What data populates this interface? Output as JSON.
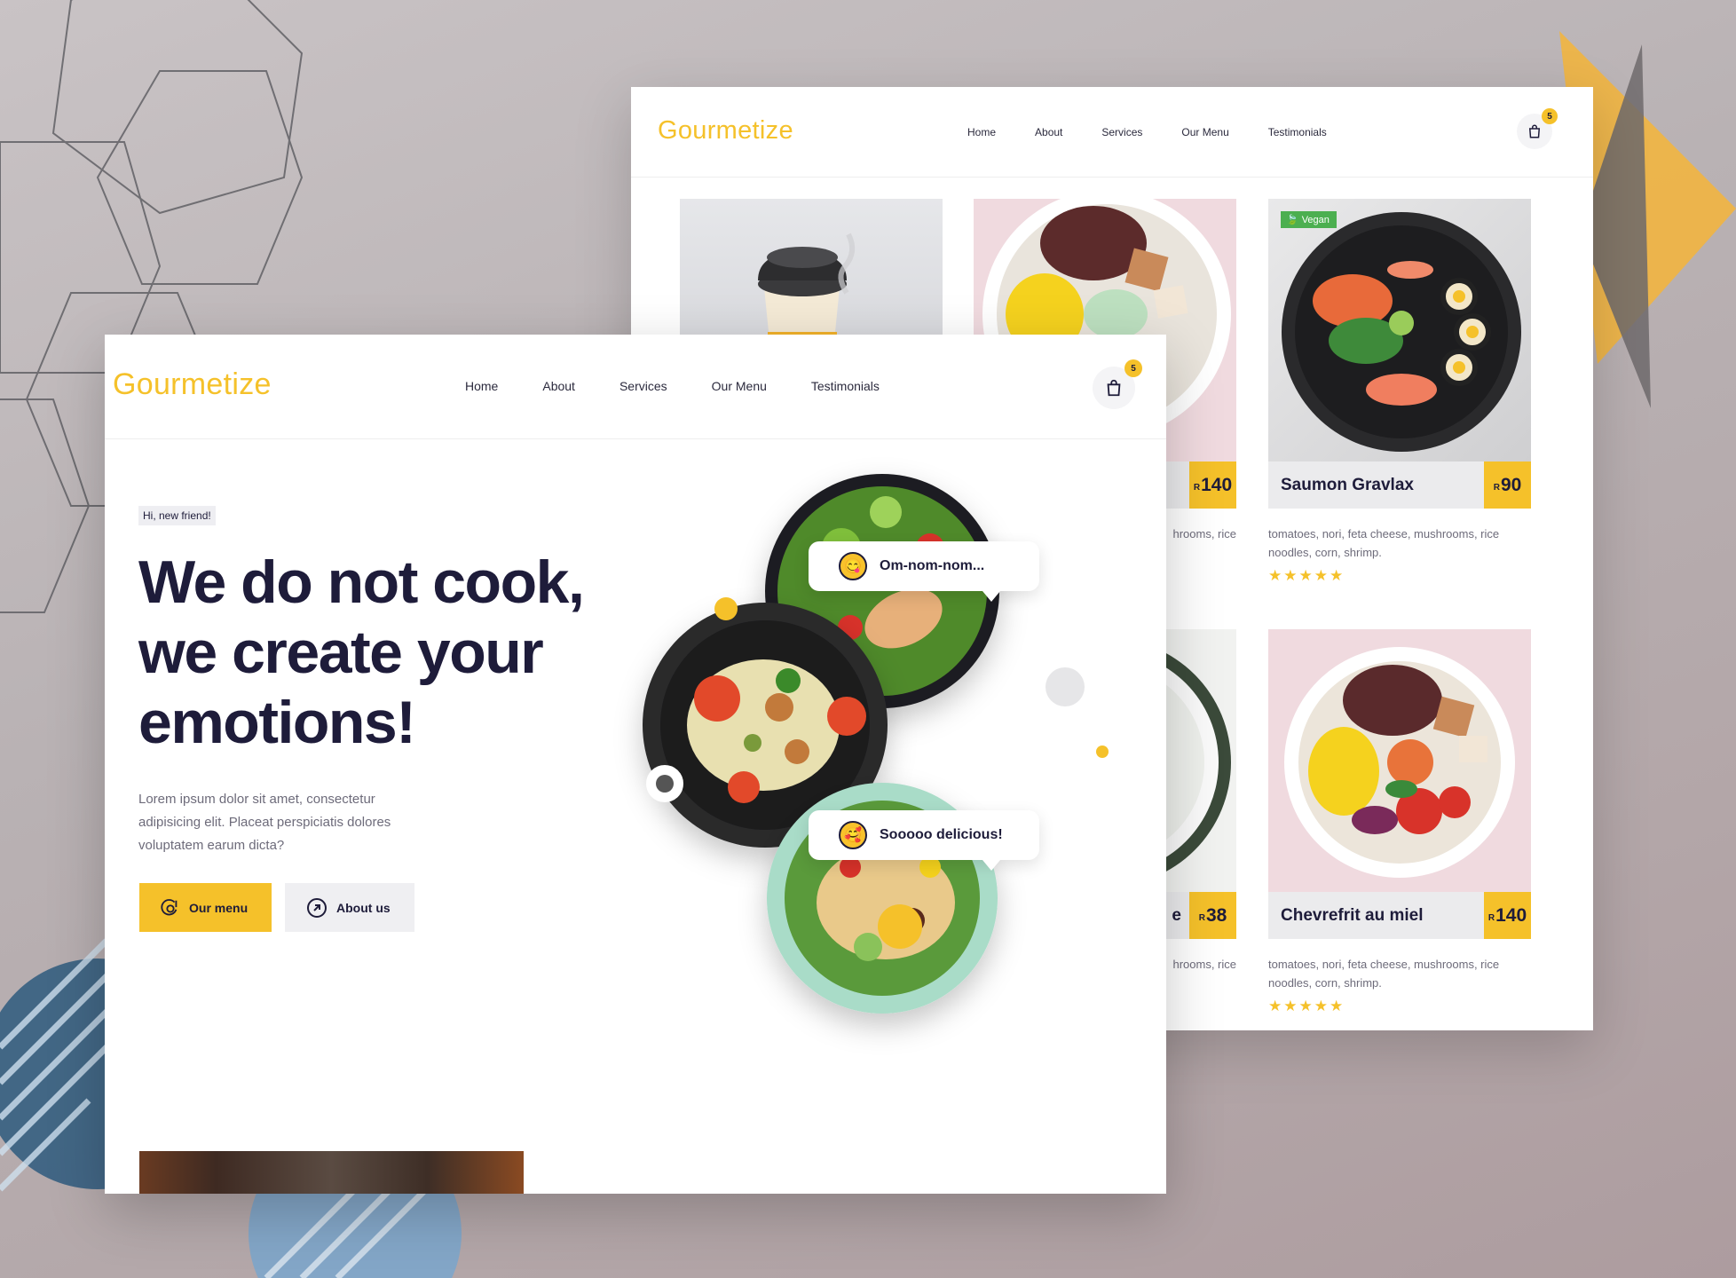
{
  "brand": "Gourmetize",
  "nav": [
    "Home",
    "About",
    "Services",
    "Our Menu",
    "Testimonials"
  ],
  "cart_count": "5",
  "colors": {
    "accent": "#f5c12a",
    "text": "#1e1c3a",
    "muted": "#6d6b7a",
    "vegan": "#4caf50"
  },
  "hero": {
    "greeting": "Hi, new friend!",
    "title": [
      "We do not cook,",
      "we create your",
      "emotions!"
    ],
    "subtitle": "Lorem ipsum dolor sit amet, consectetur adipisicing elit. Placeat perspiciatis dolores voluptatem earum dicta?",
    "primary_button": "Our menu",
    "secondary_button": "About us",
    "bubble_1": "Om-nom-nom...",
    "bubble_2": "Sooooo delicious!"
  },
  "menu": {
    "currency": "R",
    "vegan_label": "Vegan",
    "stars": "★★★★★",
    "cards": [
      {
        "name": "Saumon Gravlax",
        "price": "90",
        "desc": "tomatoes, nori, feta cheese, mushrooms, rice noodles, corn, shrimp."
      },
      {
        "name": "Chevrefrit au miel",
        "price": "140",
        "desc": "tomatoes, nori, feta cheese, mushrooms, rice noodles, corn, shrimp."
      }
    ],
    "partial": {
      "price_1": "140",
      "price_2": "38",
      "desc_1": "hrooms, rice",
      "desc_2": "hrooms, rice",
      "name_2_tail": "e"
    }
  }
}
